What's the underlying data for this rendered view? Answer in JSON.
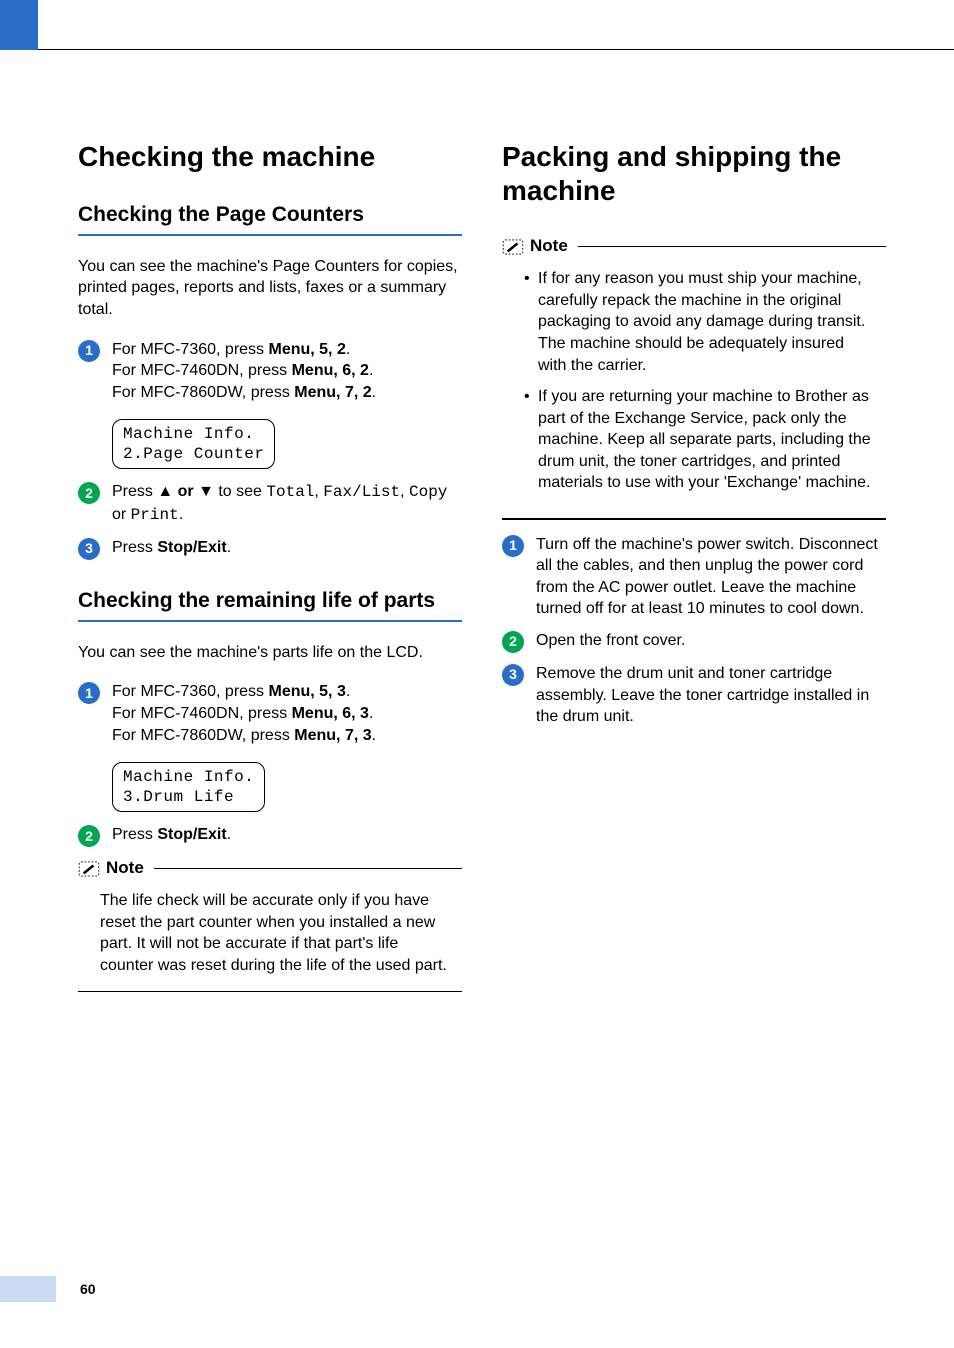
{
  "page_number": "60",
  "left": {
    "h1": "Checking the machine",
    "sec1": {
      "h2": "Checking the Page Counters",
      "intro": "You can see the machine's Page Counters for copies, printed pages, reports and lists, faxes or a summary total.",
      "step1_a": "For MFC-7360, press ",
      "step1_b": "For MFC-7460DN, press ",
      "step1_c": "For MFC-7860DW, press ",
      "menu": "Menu",
      "s1a_keys": ", 5, 2",
      "s1b_keys": ", 6, 2",
      "s1c_keys": ", 7, 2",
      "lcd_l1": "Machine Info.",
      "lcd_l2": "2.Page Counter",
      "step2_pre": "Press ",
      "step2_arrows": "▲ or ▼",
      "step2_mid": " to see ",
      "step2_code1": "Total",
      "step2_c1": ", ",
      "step2_code2": "Fax/List",
      "step2_c2": ", ",
      "step2_code3": "Copy",
      "step2_or": " or ",
      "step2_code4": "Print",
      "step2_end": ".",
      "step3_pre": "Press ",
      "step3_key": "Stop/Exit",
      "step3_end": "."
    },
    "sec2": {
      "h2": "Checking the remaining life of parts",
      "intro": "You can see the machine's parts life on the LCD.",
      "step1_a": "For MFC-7360, press ",
      "step1_b": "For MFC-7460DN, press ",
      "step1_c": "For MFC-7860DW, press ",
      "menu": "Menu",
      "s1a_keys": ", 5, 3",
      "s1b_keys": ", 6, 3",
      "s1c_keys": ", 7, 3",
      "lcd_l1": "Machine Info.",
      "lcd_l2": "3.Drum Life",
      "step2_pre": "Press ",
      "step2_key": "Stop/Exit",
      "step2_end": "."
    },
    "note": {
      "title": "Note",
      "body": "The life check will be accurate only if you have reset the part counter when you installed a new part. It will not be accurate if that part's life counter was reset during the life of the used part."
    }
  },
  "right": {
    "h1": "Packing and shipping the machine",
    "note": {
      "title": "Note",
      "items": [
        "If for any reason you must ship your machine, carefully repack the machine in the original packaging to avoid any damage during transit. The machine should be adequately insured with the carrier.",
        "If you are returning your machine to Brother as part of the Exchange Service, pack only the machine. Keep all separate parts, including the drum unit, the toner cartridges, and printed materials to use with your 'Exchange' machine."
      ]
    },
    "step1": "Turn off the machine's power switch. Disconnect all the cables, and then unplug the power cord from the AC power outlet. Leave the machine turned off for at least 10 minutes to cool down.",
    "step2": "Open the front cover.",
    "step3": "Remove the drum unit and toner cartridge assembly. Leave the toner cartridge installed in the drum unit."
  }
}
